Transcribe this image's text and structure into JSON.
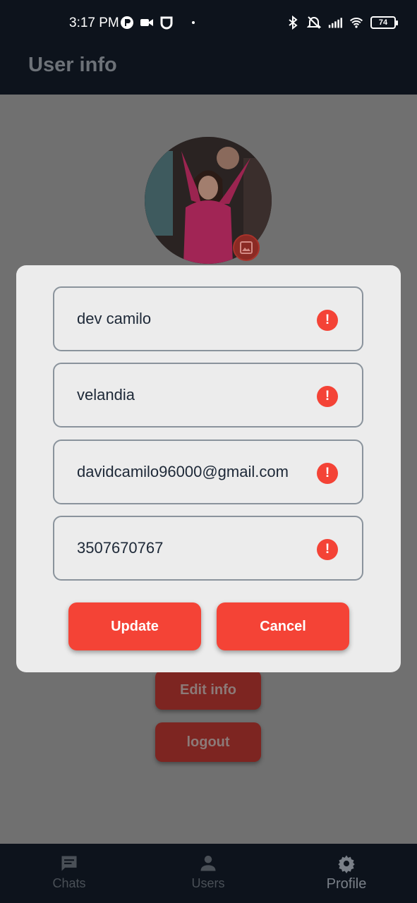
{
  "status_bar": {
    "time": "3:17 PM",
    "battery": "74",
    "left_icons": [
      "app-notification-icon",
      "video-icon",
      "shield-icon"
    ],
    "right_icons": [
      "bluetooth-icon",
      "silent-icon",
      "signal-icon",
      "wifi-icon"
    ]
  },
  "app_bar": {
    "title": "User info"
  },
  "profile": {
    "edit_label": "Edit info",
    "logout_label": "logout"
  },
  "dialog": {
    "fields": [
      {
        "value": "dev camilo"
      },
      {
        "value": "velandia"
      },
      {
        "value": "davidcamilo96000@gmail.com"
      },
      {
        "value": "3507670767"
      }
    ],
    "error_mark": "!",
    "update_label": "Update",
    "cancel_label": "Cancel"
  },
  "bottom_nav": {
    "items": [
      {
        "label": "Chats",
        "icon": "chat-icon"
      },
      {
        "label": "Users",
        "icon": "person-icon"
      },
      {
        "label": "Profile",
        "icon": "gear-icon"
      }
    ],
    "active": "Profile"
  },
  "colors": {
    "accent": "#f44336",
    "app_bar": "#0d131c",
    "scrim": "#707070",
    "dialog_bg": "#ececec"
  }
}
